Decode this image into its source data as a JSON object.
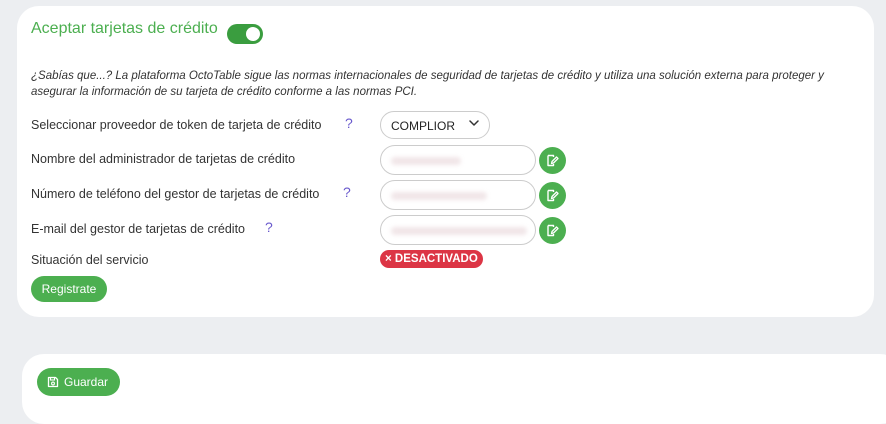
{
  "section": {
    "title": "Aceptar tarjetas de crédito",
    "toggle_on": true,
    "info": "¿Sabías que...? La plataforma OctoTable sigue las normas internacionales de seguridad de tarjetas de crédito y utiliza una solución externa para proteger y asegurar la información de su tarjeta de crédito conforme a las normas PCI."
  },
  "fields": {
    "provider": {
      "label": "Seleccionar proveedor de token de tarjeta de crédito",
      "help": "?",
      "value": "COMPLIOR"
    },
    "admin_name": {
      "label": "Nombre del administrador de tarjetas de crédito"
    },
    "phone": {
      "label": "Número de teléfono del gestor de tarjetas de crédito",
      "help": "?"
    },
    "email": {
      "label": "E-mail del gestor de tarjetas de crédito",
      "help": "?"
    },
    "status": {
      "label": "Situación del servicio",
      "badge": "DESACTIVADO",
      "badge_icon": "×"
    }
  },
  "buttons": {
    "register": "Registrate",
    "save": "Guardar"
  },
  "colors": {
    "accent": "#4caf50",
    "danger": "#dc3545",
    "help": "#6a5acd"
  }
}
